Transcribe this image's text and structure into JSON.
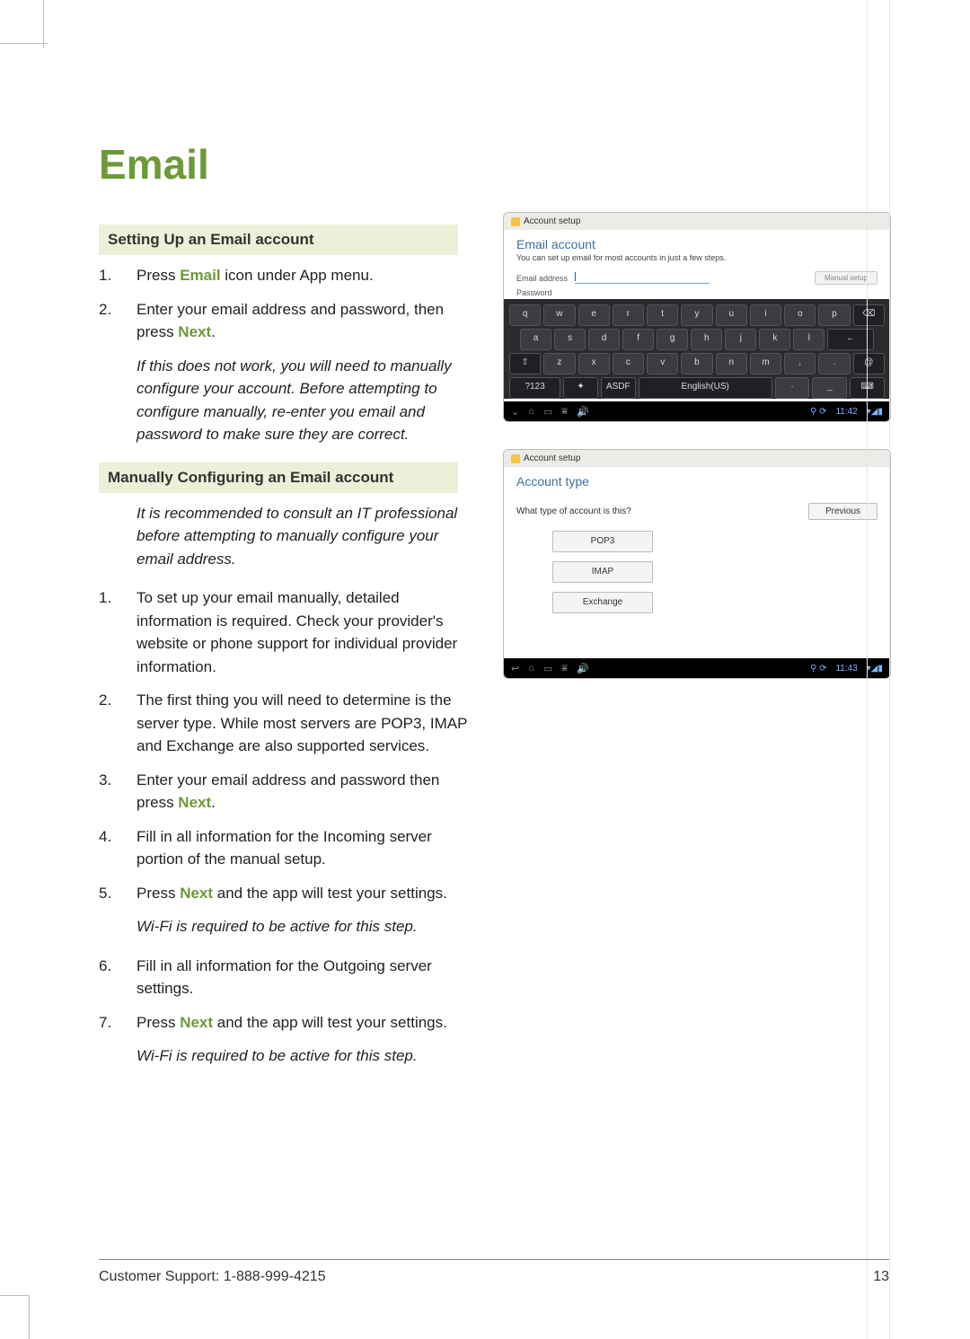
{
  "title": "Email",
  "section1": {
    "heading": "Setting Up an Email account",
    "steps": [
      {
        "n": "1.",
        "pre": "Press ",
        "bold": "Email",
        "post": " icon under App menu."
      },
      {
        "n": "2.",
        "pre": "Enter your email address and password, then press ",
        "bold": "Next",
        "post": "."
      }
    ],
    "note": "If this does not work, you will need to manually configure your account. Before attempting to configure manually, re-enter you email and password to make sure they are correct."
  },
  "section2": {
    "heading": "Manually Configuring an Email account",
    "intro_note": "It is recommended to consult an IT professional before attempting to manually configure your email address.",
    "steps": [
      {
        "n": "1.",
        "txt": "To set up your email manually, detailed information is required. Check your provider's website or phone support for individual provider information."
      },
      {
        "n": "2.",
        "txt": "The first thing you will need to determine is the server type. While most servers are POP3, IMAP and Exchange are also supported services."
      },
      {
        "n": "3.",
        "pre": "Enter your email address and password then press ",
        "bold": "Next",
        "post": "."
      },
      {
        "n": "4.",
        "txt": "Fill in all information for the Incoming server portion of the manual setup."
      },
      {
        "n": "5.",
        "pre": "Press ",
        "bold": "Next",
        "post": " and the app will test your settings.",
        "after_note": "Wi-Fi is required to be active for this step."
      },
      {
        "n": "6.",
        "txt": "Fill in all information for the Outgoing server settings."
      },
      {
        "n": "7.",
        "pre": "Press ",
        "bold": "Next",
        "post": " and the app will test your settings.",
        "after_note": "Wi-Fi is required to be active for this step."
      }
    ]
  },
  "screenshot1": {
    "window_title": "Account setup",
    "heading": "Email account",
    "sub": "You can set up email for most accounts in just a few steps.",
    "email_label": "Email address",
    "password_label": "Password",
    "manual_btn": "Manual setup",
    "kbd_rows": [
      [
        "q",
        "w",
        "e",
        "r",
        "t",
        "y",
        "u",
        "i",
        "o",
        "p",
        "⌫"
      ],
      [
        "a",
        "s",
        "d",
        "f",
        "g",
        "h",
        "j",
        "k",
        "l",
        "←"
      ],
      [
        "⇧",
        "z",
        "x",
        "c",
        "v",
        "b",
        "n",
        "m",
        ",",
        ".",
        "@"
      ],
      [
        "?123",
        "✦",
        "ASDF",
        "English(US)",
        "·",
        "_",
        "⌨"
      ]
    ],
    "clock": "11:42"
  },
  "screenshot2": {
    "window_title": "Account setup",
    "heading": "Account type",
    "question": "What type of account is this?",
    "prev": "Previous",
    "options": [
      "POP3",
      "IMAP",
      "Exchange"
    ],
    "clock": "11:43"
  },
  "footer": {
    "support": "Customer Support: 1-888-999-4215",
    "page": "13"
  }
}
